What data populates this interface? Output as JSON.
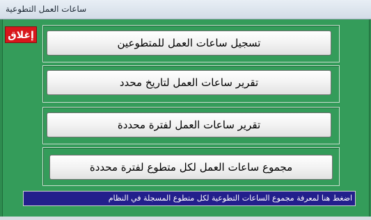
{
  "window": {
    "title": "ساعات العمل التطوعية"
  },
  "close_button": {
    "label": "إغلاق"
  },
  "menu": {
    "buttons": [
      {
        "label": "تسجيل ساعات العمل للمتطوعين"
      },
      {
        "label": "تقرير ساعات العمل لتاريخ محدد"
      },
      {
        "label": "تقرير ساعات العمل لفترة محددة"
      },
      {
        "label": "مجموع ساعات العمل لكل متطوع لفترة محددة"
      }
    ]
  },
  "status_bar": {
    "text": "اضغط هنا لمعرفة مجموع الساعات التطوعية لكل متطوع المسجلة في النظام"
  },
  "colors": {
    "background": "#349c5a",
    "close_button": "#d8171c",
    "status_bar": "#231f8c"
  }
}
